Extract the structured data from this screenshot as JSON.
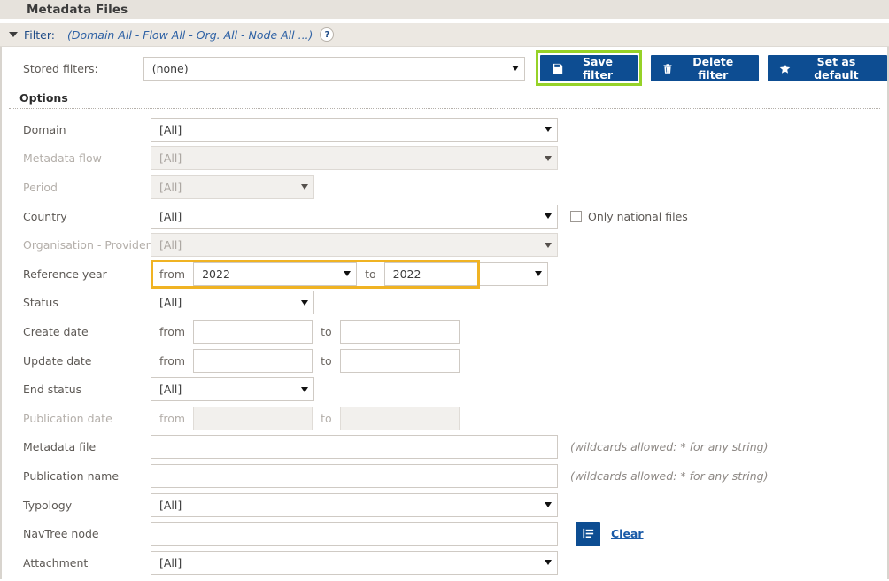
{
  "page": {
    "title": "Metadata Files"
  },
  "filter_bar": {
    "label": "Filter:",
    "summary": "(Domain All - Flow All - Org. All - Node All ...)",
    "help_icon": "?",
    "toggle_icon": "triangle-down-icon"
  },
  "stored_filters": {
    "label": "Stored filters:",
    "value": "(none)",
    "buttons": [
      {
        "label": "Save filter",
        "icon": "save-icon",
        "highlighted": true
      },
      {
        "label": "Delete filter",
        "icon": "trash-icon",
        "highlighted": false
      },
      {
        "label": "Set as default",
        "icon": "star-icon",
        "highlighted": false
      }
    ]
  },
  "options": {
    "heading": "Options",
    "rows": {
      "domain": {
        "label": "Domain",
        "value": "[All]"
      },
      "metadata_flow": {
        "label": "Metadata flow",
        "value": "[All]"
      },
      "period": {
        "label": "Period",
        "value": "[All]"
      },
      "country": {
        "label": "Country",
        "value": "[All]"
      },
      "only_national": {
        "label": "Only national files",
        "checked": false
      },
      "organisation_provider": {
        "label": "Organisation - Provider",
        "value": "[All]"
      },
      "reference_year": {
        "label": "Reference year",
        "from_label": "from",
        "from_value": "2022",
        "to_label": "to",
        "to_value": "2022",
        "highlight_color": "#f0b323"
      },
      "status": {
        "label": "Status",
        "value": "[All]"
      },
      "create_date": {
        "label": "Create date",
        "from_label": "from",
        "from_value": "",
        "to_label": "to",
        "to_value": ""
      },
      "update_date": {
        "label": "Update date",
        "from_label": "from",
        "from_value": "",
        "to_label": "to",
        "to_value": ""
      },
      "end_status": {
        "label": "End status",
        "value": "[All]"
      },
      "publication_date": {
        "label": "Publication date",
        "from_label": "from",
        "from_value": "",
        "to_label": "to",
        "to_value": ""
      },
      "metadata_file": {
        "label": "Metadata file",
        "value": "",
        "hint": "(wildcards allowed: * for any string)"
      },
      "publication_name": {
        "label": "Publication name",
        "value": "",
        "hint": "(wildcards allowed: * for any string)"
      },
      "typology": {
        "label": "Typology",
        "value": "[All]"
      },
      "navtree_node": {
        "label": "NavTree node",
        "value": ""
      },
      "attachment": {
        "label": "Attachment",
        "value": "[All]"
      }
    },
    "clear": {
      "label": "Clear",
      "icon": "clear-form-icon"
    }
  },
  "colors": {
    "primary_button": "#0d4d92",
    "highlight_green": "#96d228",
    "highlight_amber": "#f0b323",
    "link": "#1a5ba8"
  }
}
